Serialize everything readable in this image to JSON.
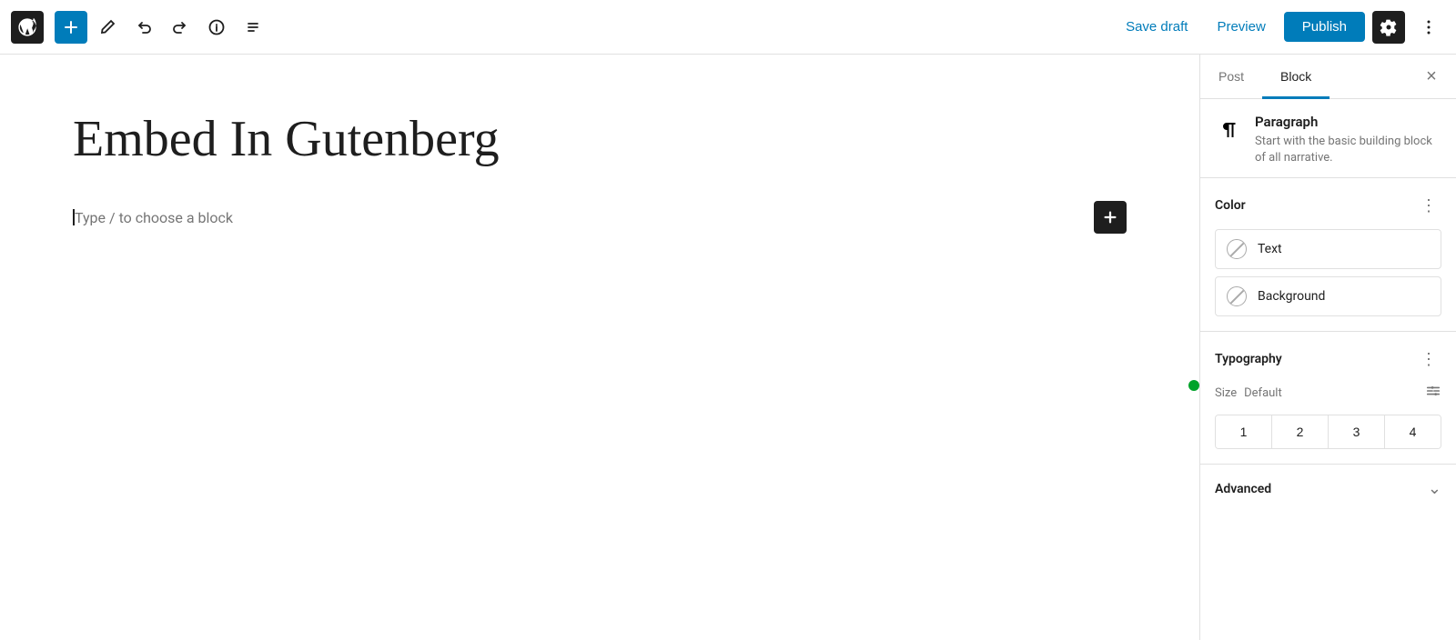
{
  "toolbar": {
    "add_label": "+",
    "save_draft": "Save draft",
    "preview": "Preview",
    "publish": "Publish",
    "undo_title": "Undo",
    "redo_title": "Redo",
    "info_title": "Details",
    "list_view_title": "List view",
    "more_title": "Options"
  },
  "editor": {
    "post_title": "Embed In Gutenberg",
    "placeholder_text": "Type / to choose a block"
  },
  "sidebar": {
    "tab_post": "Post",
    "tab_block": "Block",
    "close_label": "×",
    "block_name": "Paragraph",
    "block_desc": "Start with the basic building block of all narrative.",
    "color_section_title": "Color",
    "text_color_label": "Text",
    "background_color_label": "Background",
    "typography_section_title": "Typography",
    "size_label": "Size",
    "size_value": "Default",
    "font_sizes": [
      "1",
      "2",
      "3",
      "4"
    ],
    "advanced_section_title": "Advanced"
  },
  "colors": {
    "accent": "#007cba",
    "dark": "#1e1e1e",
    "green": "#00a32a"
  }
}
